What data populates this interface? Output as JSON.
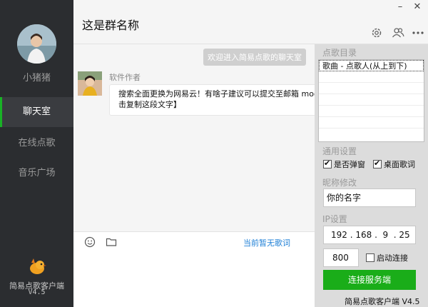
{
  "sidebar": {
    "username": "小猪猪",
    "nav": [
      {
        "label": "聊天室",
        "active": true
      },
      {
        "label": "在线点歌",
        "active": false
      },
      {
        "label": "音乐广场",
        "active": false
      }
    ],
    "app_name": "简易点歌客户端",
    "app_version": "V4.5"
  },
  "header": {
    "title": "这是群名称",
    "window_controls": {
      "minimize": "–",
      "close": "✕"
    },
    "icons": [
      "gear-icon",
      "group-icon",
      "more-icon"
    ]
  },
  "chat": {
    "system_message": "欢迎进入简易点歌的聊天室",
    "messages": [
      {
        "author": "软件作者",
        "line1": "搜索全面更换为网易云！有啥子建议可以提交至邮箱  moon_",
        "line2": "击复制这段文字】"
      }
    ]
  },
  "toolbar": {
    "icons": [
      "emoji-icon",
      "folder-icon"
    ],
    "no_lyric": "当前暂无歌词"
  },
  "right_panel": {
    "song_catalog_label": "点歌目录",
    "song_list_header": "歌曲 - 点歌人(从上到下)",
    "general_settings_label": "通用设置",
    "checkbox_danmaku": {
      "label": "是否弹窗",
      "checked": true
    },
    "checkbox_lyrics": {
      "label": "桌面歌词",
      "checked": true
    },
    "nickname_label": "昵称修改",
    "nickname_value": "你的名字",
    "ip_label": "IP设置",
    "ip_value": "192 . 168 .  9  . 25",
    "port_value": "800",
    "checkbox_autoconnect": {
      "label": "启动连接",
      "checked": false
    },
    "connect_button": "连接服务端",
    "bottom_label": "简易点歌客户端 V4.5"
  },
  "colors": {
    "sidebar_bg": "#2b2d30",
    "accent_green": "#1aad19",
    "link_blue": "#1e7fd6",
    "system_bubble": "#cfcfcf"
  }
}
